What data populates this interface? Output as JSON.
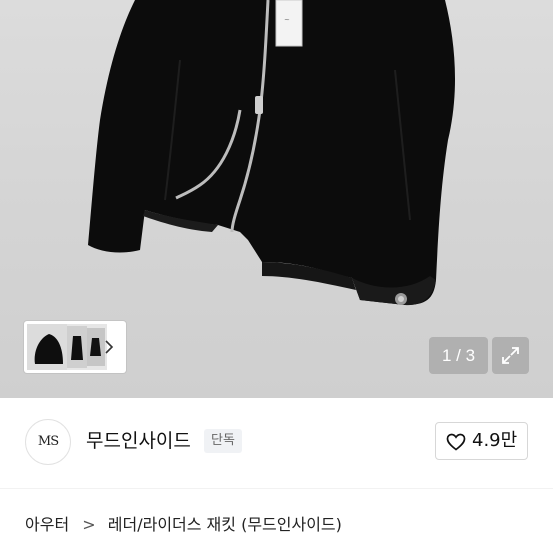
{
  "gallery": {
    "counter_current": 1,
    "counter_total": 3,
    "counter_text": "1 / 3",
    "thumbnail_count": 3,
    "next_icon": "chevron-right-icon",
    "expand_icon": "expand-icon"
  },
  "shop": {
    "logo_text": "MS",
    "name": "무드인사이드",
    "badge": "단독",
    "like_icon": "heart-icon",
    "like_count": "4.9만"
  },
  "breadcrumb": {
    "category": "아우터",
    "separator": ">",
    "product": "레더/라이더스 재킷 (무드인사이드)"
  },
  "colors": {
    "image_background": "#d6d6d6",
    "overlay_button": "#969696",
    "badge_background": "#f0f2f5",
    "text_primary": "#111111"
  }
}
